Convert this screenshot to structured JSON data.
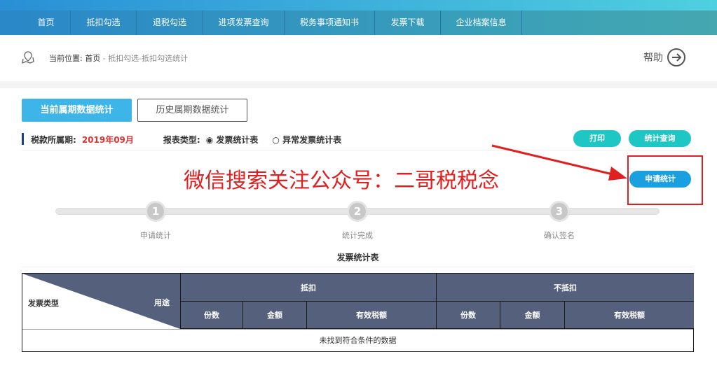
{
  "nav": [
    "首页",
    "抵扣勾选",
    "退税勾选",
    "进项发票查询",
    "税务事项通知书",
    "发票下载",
    "企业档案信息"
  ],
  "breadcrumb": {
    "label": "当前位置:",
    "home": "首页",
    "sep": " - ",
    "path": "抵扣勾选-抵扣勾选统计"
  },
  "help": "帮助",
  "tabs": {
    "current": "当前属期数据统计",
    "history": "历史属期数据统计"
  },
  "filters": {
    "period_label": "税款所属期:",
    "period_value": "2019年09月",
    "type_label": "报表类型:",
    "option1": "发票统计表",
    "option2": "异常发票统计表"
  },
  "buttons": {
    "print": "打印",
    "query": "统计查询",
    "apply": "申请统计"
  },
  "watermark": "微信搜索关注公众号：二哥税税念",
  "steps": [
    {
      "num": "1",
      "label": "申请统计"
    },
    {
      "num": "2",
      "label": "统计完成"
    },
    {
      "num": "3",
      "label": "确认签名"
    }
  ],
  "table": {
    "title": "发票统计表",
    "corner_left": "发票类型",
    "corner_right": "用途",
    "group1": "抵扣",
    "group2": "不抵扣",
    "cols": [
      "份数",
      "金额",
      "有效税额",
      "份数",
      "金额",
      "有效税额"
    ],
    "empty": "未找到符合条件的数据"
  },
  "colors": {
    "accent": "#3db5e8",
    "teal": "#1fc7c4",
    "header": "#55607d",
    "red": "#e02020"
  }
}
